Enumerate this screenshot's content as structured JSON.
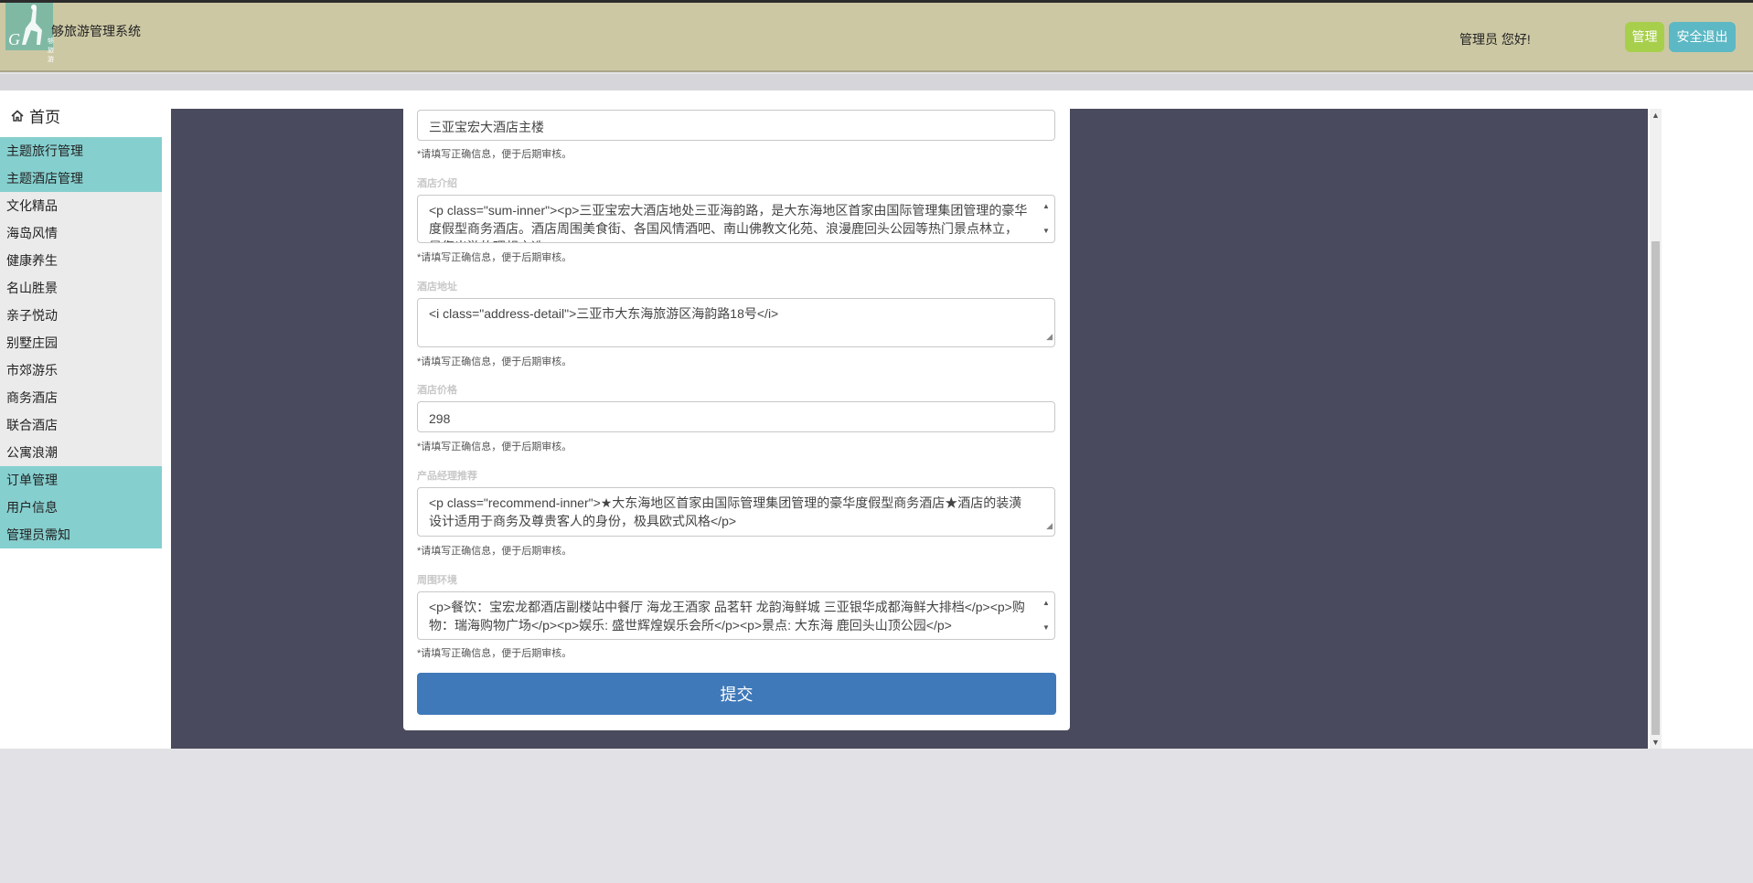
{
  "header": {
    "logo_text": "够旅游",
    "system_title": "够旅游管理系统",
    "greeting": "管理员 您好!",
    "manage_label": "管理",
    "logout_label": "安全退出"
  },
  "sidebar": {
    "home_label": "首页",
    "items": [
      {
        "label": "主题旅行管理",
        "primary": true
      },
      {
        "label": "主题酒店管理",
        "primary": true
      },
      {
        "label": "文化精品",
        "primary": false
      },
      {
        "label": "海岛风情",
        "primary": false
      },
      {
        "label": "健康养生",
        "primary": false
      },
      {
        "label": "名山胜景",
        "primary": false
      },
      {
        "label": "亲子悦动",
        "primary": false
      },
      {
        "label": "别墅庄园",
        "primary": false
      },
      {
        "label": "市郊游乐",
        "primary": false
      },
      {
        "label": "商务酒店",
        "primary": false
      },
      {
        "label": "联合酒店",
        "primary": false
      },
      {
        "label": "公寓浪潮",
        "primary": false
      },
      {
        "label": "订单管理",
        "primary": true
      },
      {
        "label": "用户信息",
        "primary": true
      },
      {
        "label": "管理员需知",
        "primary": true
      }
    ]
  },
  "form": {
    "hint": "*请填写正确信息，便于后期审核。",
    "hotel_name": "三亚宝宏大酒店主楼",
    "intro_label": "酒店介绍",
    "intro_value": "<p class=\"sum-inner\"><p>三亚宝宏大酒店地处三亚海韵路，是大东海地区首家由国际管理集团管理的豪华度假型商务酒店。酒店周围美食街、各国风情酒吧、南山佛教文化苑、浪漫鹿回头公园等热门景点林立，是您出游的理想之选。",
    "address_label": "酒店地址",
    "address_value": "<i class=\"address-detail\">三亚市大东海旅游区海韵路18号</i>",
    "price_label": "酒店价格",
    "price_value": "298",
    "recommend_label": "产品经理推荐",
    "recommend_value": "<p class=\"recommend-inner\">★大东海地区首家由国际管理集团管理的豪华度假型商务酒店★酒店的装潢设计适用于商务及尊贵客人的身份，极具欧式风格</p>",
    "env_label": "周围环境",
    "env_value": "<p>餐饮：宝宏龙都酒店副楼站中餐厅  海龙王酒家  品茗轩  龙韵海鲜城  三亚银华成都海鲜大排档</p><p>购物：瑞海购物广场</p><p>娱乐: 盛世辉煌娱乐会所</p><p>景点: 大东海  鹿回头山顶公园</p>",
    "submit_label": "提交"
  }
}
